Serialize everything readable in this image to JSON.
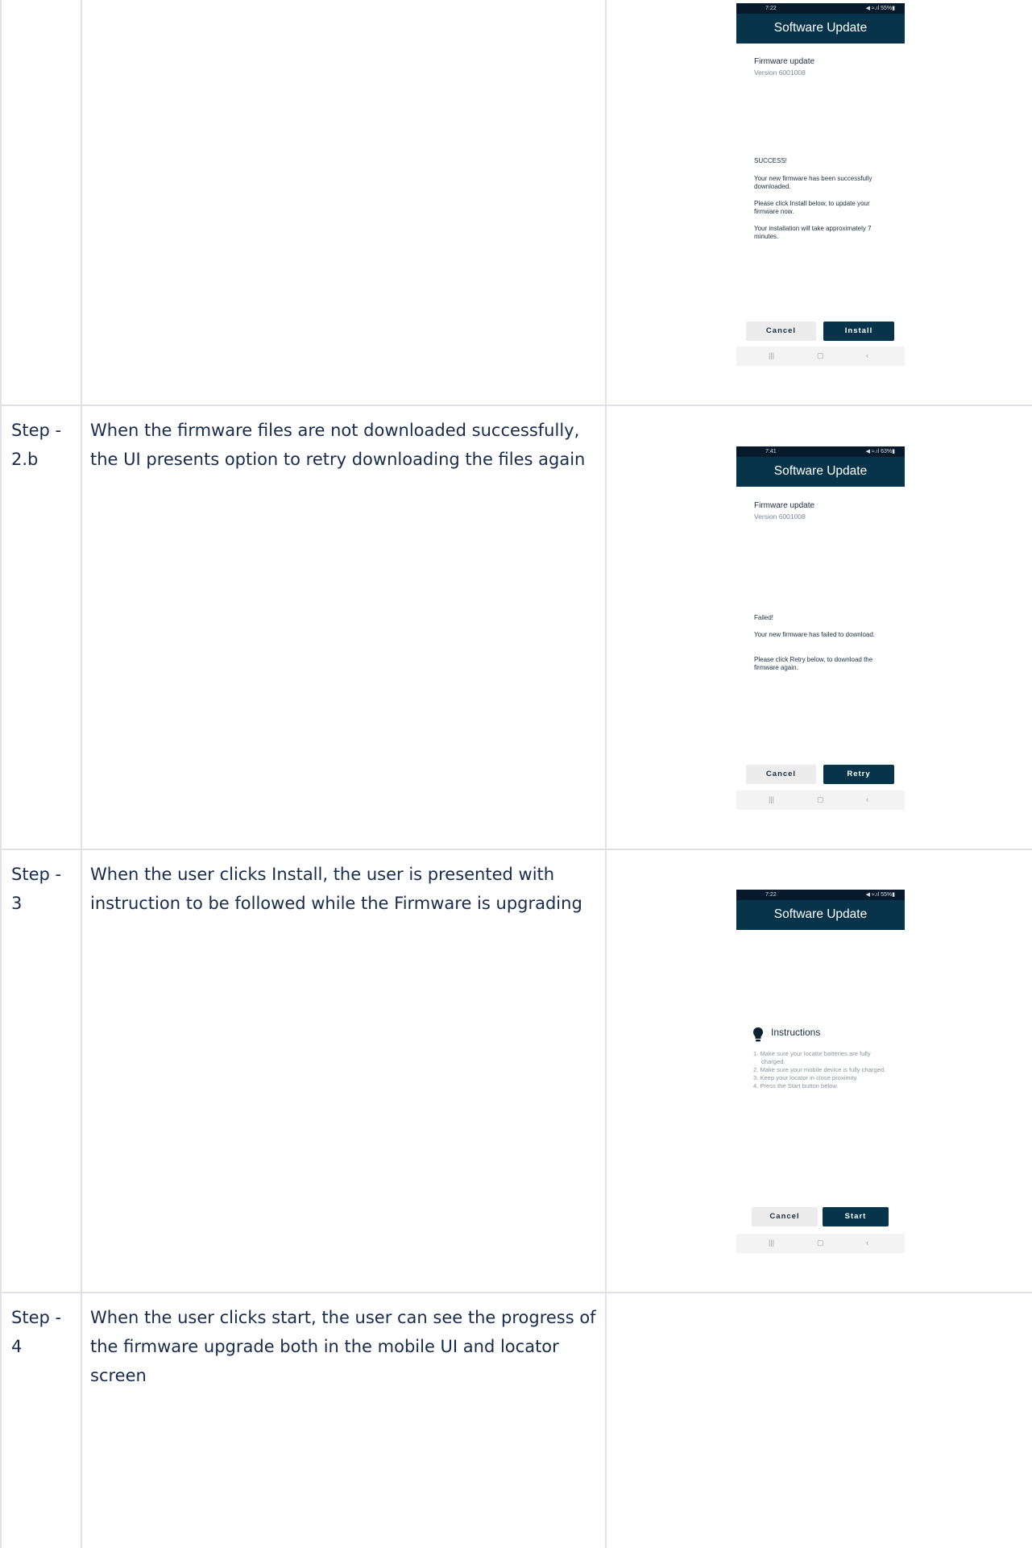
{
  "rows": [
    {
      "label": "",
      "description": "",
      "phone": {
        "status_time": "7:22",
        "status_right": "◀ ≈.ıl 55%▮",
        "title": "Software Update",
        "fw_title": "Firmware update",
        "fw_version": "Version 6001008",
        "messages": [
          "SUCCESS!",
          "Your new firmware has been successfully downloaded.",
          "Please click Install below, to update your firmware now.",
          "Your installation will take approximately 7 minutes."
        ],
        "cancel_label": "Cancel",
        "primary_label": "Install"
      }
    },
    {
      "label": "Step - 2.b",
      "description": "When the firmware files are not downloaded successfully, the UI presents option to retry downloading the files again",
      "phone": {
        "status_time": "7:41",
        "status_right": "◀ ≈.ıl 63%▮",
        "title": "Software Update",
        "fw_title": "Firmware update",
        "fw_version": "Version 6001008",
        "messages": [
          "Failed!",
          "Your new firmware has failed to download.",
          "Please click Retry below, to download the firmware again."
        ],
        "cancel_label": "Cancel",
        "primary_label": "Retry"
      }
    },
    {
      "label": "Step - 3",
      "description": "When the user clicks Install, the user is presented with instruction to be followed while the Firmware is upgrading",
      "phone": {
        "status_time": "7:22",
        "status_right": "◀ ≈.ıl 55%▮",
        "title": "Software Update",
        "instructions_title": "Instructions",
        "instructions": [
          "1. Make sure your locator batteries are fully charged.",
          "2. Make sure your mobile device is fully charged.",
          "3. Keep your locator in close proximity.",
          "4. Press the Start button below."
        ],
        "cancel_label": "Cancel",
        "primary_label": "Start"
      }
    },
    {
      "label": "Step - 4",
      "description": "When the user clicks start, the user can see the progress of the firmware upgrade both in the mobile UI and locator screen"
    }
  ],
  "icons": {
    "nav_recent": "|||",
    "nav_home": "▢",
    "nav_back": "‹"
  }
}
